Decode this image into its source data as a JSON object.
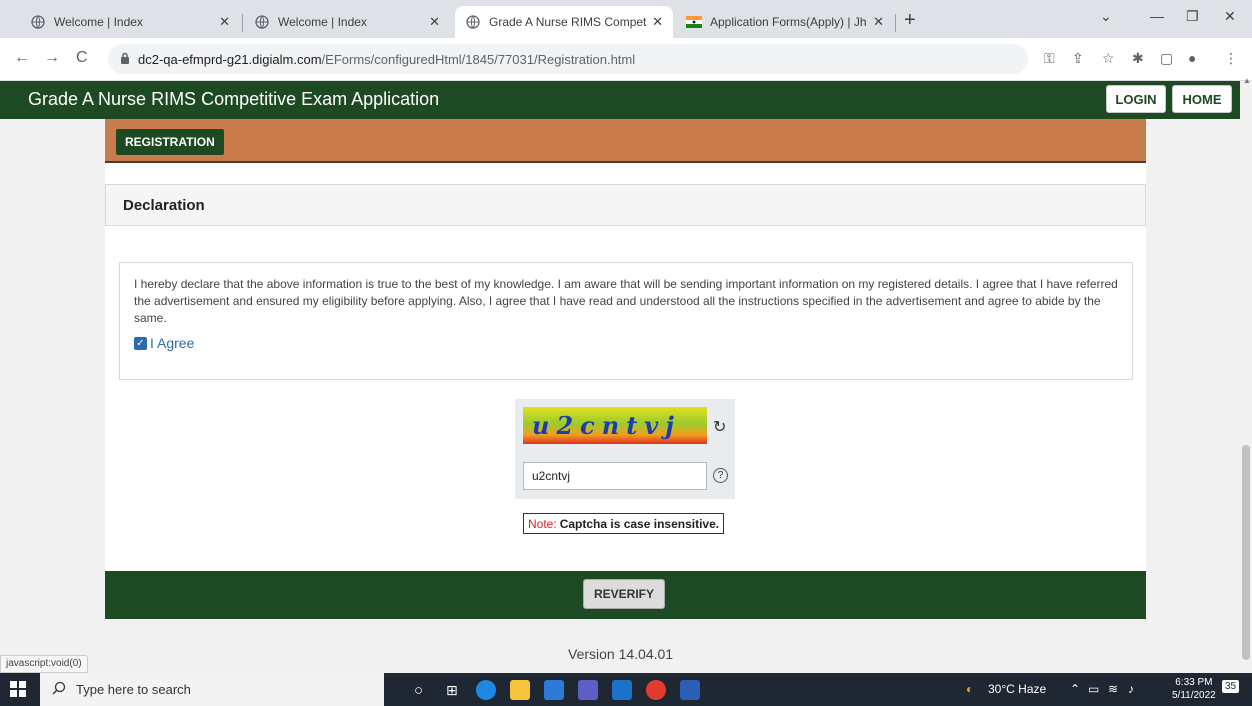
{
  "browser": {
    "tabs": [
      {
        "title": "Welcome | Index",
        "active": false
      },
      {
        "title": "Welcome | Index",
        "active": false
      },
      {
        "title": "Grade A Nurse RIMS Competitive",
        "active": true
      },
      {
        "title": "Application Forms(Apply) | Jharkh",
        "active": false
      }
    ],
    "url_host": "dc2-qa-efmprd-g21.digialm.com",
    "url_path": "/EForms/configuredHtml/1845/77031/Registration.html"
  },
  "header": {
    "title": "Grade A Nurse RIMS Competitive Exam Application",
    "login_label": "LOGIN",
    "home_label": "HOME"
  },
  "registration": {
    "button_label": "REGISTRATION"
  },
  "declaration": {
    "heading": "Declaration",
    "text": "I hereby declare that the above information is true to the best of my knowledge. I am aware that will be sending important information on my registered details. I agree that I have referred the advertisement and ensured my eligibility before applying. Also, I agree that I have read and understood all the instructions specified in the advertisement and agree to abide by the same.",
    "agree_label": "I Agree",
    "agree_checked": true
  },
  "captcha": {
    "image_text": "u2cntvj",
    "input_value": "u2cntvj",
    "note_label": "Note:",
    "note_text": "Captcha is case insensitive."
  },
  "footer": {
    "reverify_label": "REVERIFY",
    "version": "Version 14.04.01"
  },
  "statusbar": {
    "text": "javascript:void(0)"
  },
  "taskbar": {
    "search_placeholder": "Type here to search",
    "weather": "30°C  Haze",
    "time": "6:33 PM",
    "date": "5/11/2022",
    "notification_count": "35"
  }
}
